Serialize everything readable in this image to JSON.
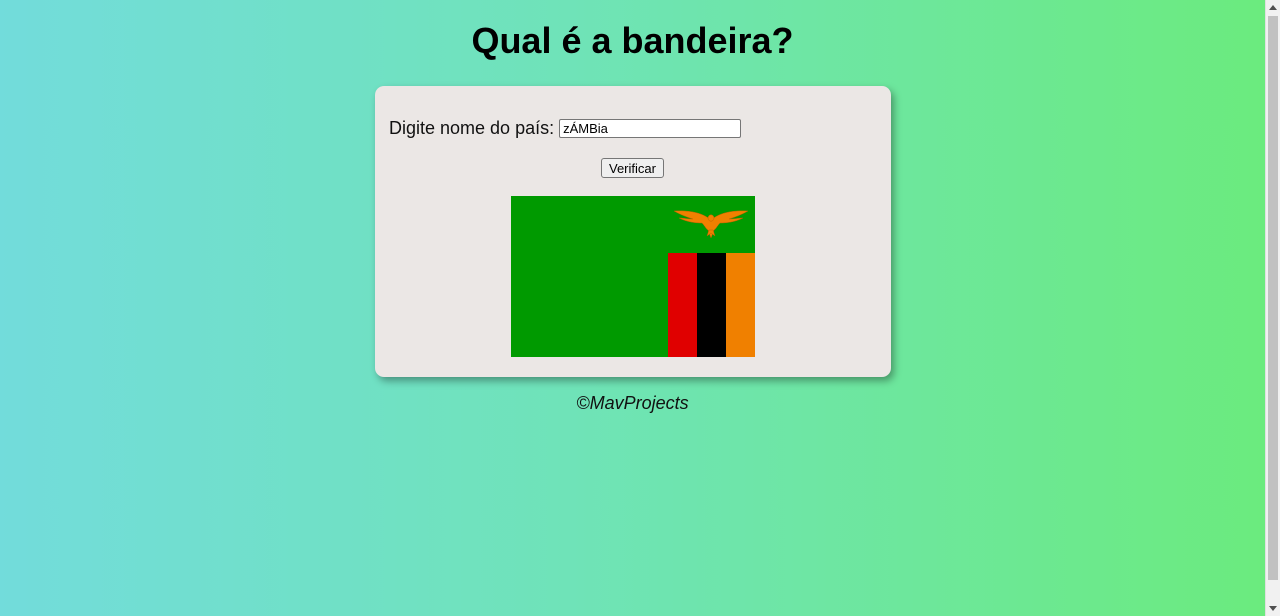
{
  "page": {
    "title": "Qual é a bandeira?",
    "footer": "©MavProjects"
  },
  "form": {
    "label": "Digite nome do país:",
    "value": "zÁMBia",
    "button_label": "Verificar"
  },
  "flag": {
    "country_shown": "Zambia",
    "colors": {
      "field": "#009a00",
      "red": "#e00000",
      "black": "#000000",
      "orange": "#f08000",
      "eagle": "#f08000"
    }
  },
  "colors": {
    "background_left": "#72dcdb",
    "background_right": "#6beb7e",
    "card": "#ebe7e5"
  }
}
